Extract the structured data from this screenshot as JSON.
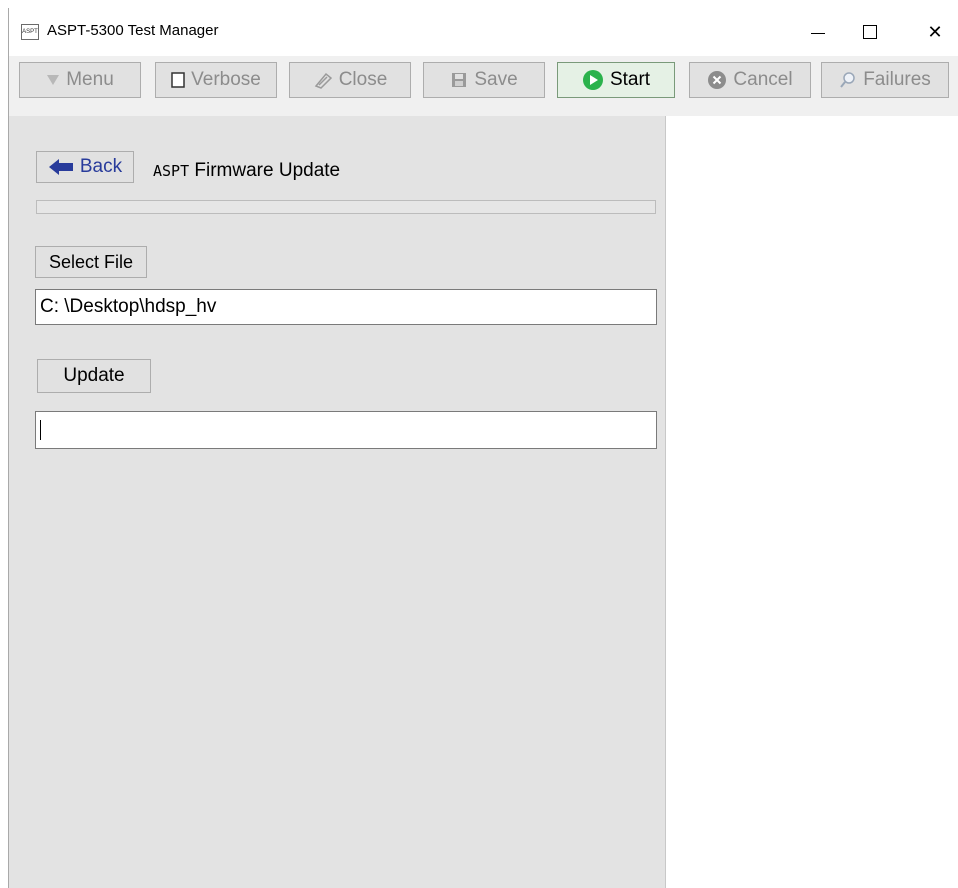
{
  "window": {
    "icon_text": "ASPT",
    "title": "ASPT-5300 Test Manager",
    "controls": {
      "minimize": "–",
      "maximize": "☐",
      "close": "✕"
    }
  },
  "toolbar": {
    "buttons": [
      {
        "label": "Menu",
        "icon": "menu-triangle-icon",
        "enabled": false
      },
      {
        "label": "Verbose",
        "icon": "checkbox-icon",
        "enabled": false
      },
      {
        "label": "Close",
        "icon": "close-document-icon",
        "enabled": false
      },
      {
        "label": "Save",
        "icon": "floppy-disk-icon",
        "enabled": false
      },
      {
        "label": "Start",
        "icon": "green-play-icon",
        "enabled": true
      },
      {
        "label": "Cancel",
        "icon": "cancel-circle-icon",
        "enabled": false
      },
      {
        "label": "Failures",
        "icon": "magnifier-icon",
        "enabled": false
      }
    ]
  },
  "main": {
    "back_label": "Back",
    "page_title_tag": "ASPT",
    "page_title_text": "Firmware Update",
    "progress_fraction": 0,
    "select_file_label": "Select File",
    "file_path": "C: \\Desktop\\hdsp_hv",
    "update_label": "Update",
    "status_text": ""
  },
  "colors": {
    "start_accent": "#2bb24c",
    "back_arrow": "#283b9b",
    "left_pane_bg": "#e3e3e3"
  }
}
